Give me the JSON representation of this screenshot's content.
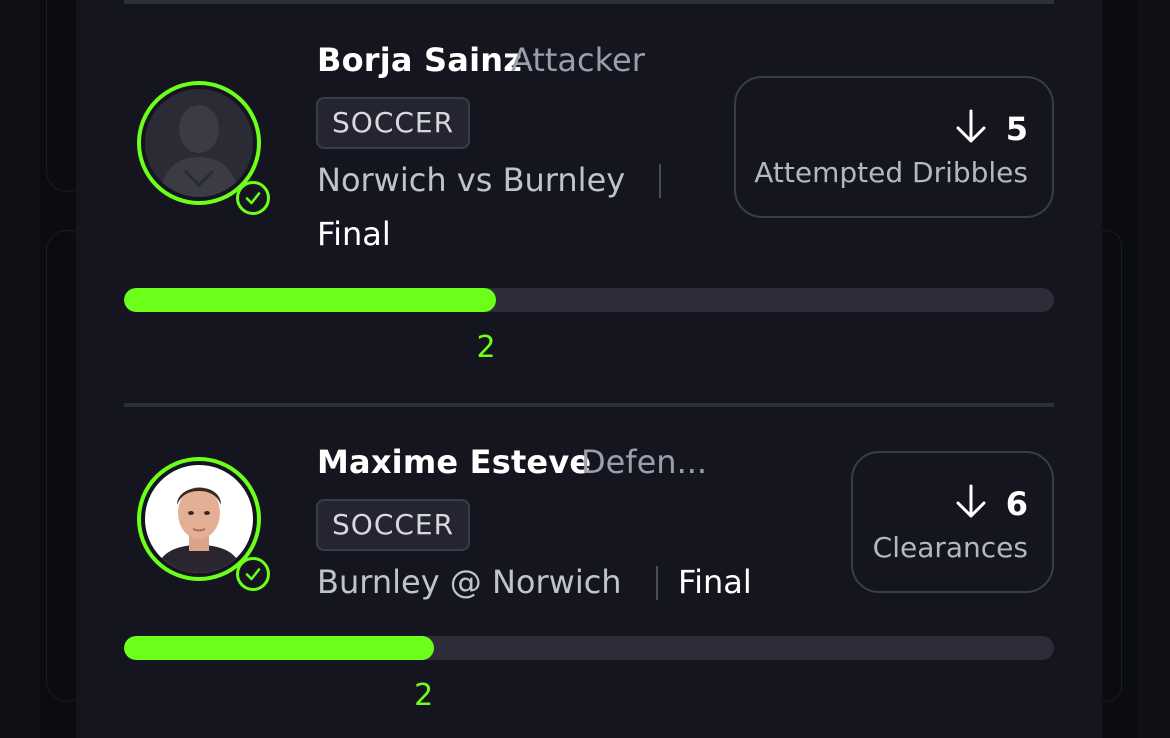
{
  "accent_color": "#6cff1a",
  "cards": [
    {
      "player_name": "Borja Sainz",
      "position": "Attacker",
      "sport": "SOCCER",
      "matchup": "Norwich vs Burnley",
      "status": "Final",
      "stat_direction_icon": "arrow-down-icon",
      "stat_value": "5",
      "stat_label": "Attempted Dribbles",
      "progress_fraction": 0.4,
      "progress_count": "2",
      "avatar": "silhouette"
    },
    {
      "player_name": "Maxime Esteve",
      "position": "Defen...",
      "sport": "SOCCER",
      "matchup": "Burnley @ Norwich",
      "status": "Final",
      "stat_direction_icon": "arrow-down-icon",
      "stat_value": "6",
      "stat_label": "Clearances",
      "progress_fraction": 0.333,
      "progress_count": "2",
      "avatar": "photo"
    }
  ]
}
